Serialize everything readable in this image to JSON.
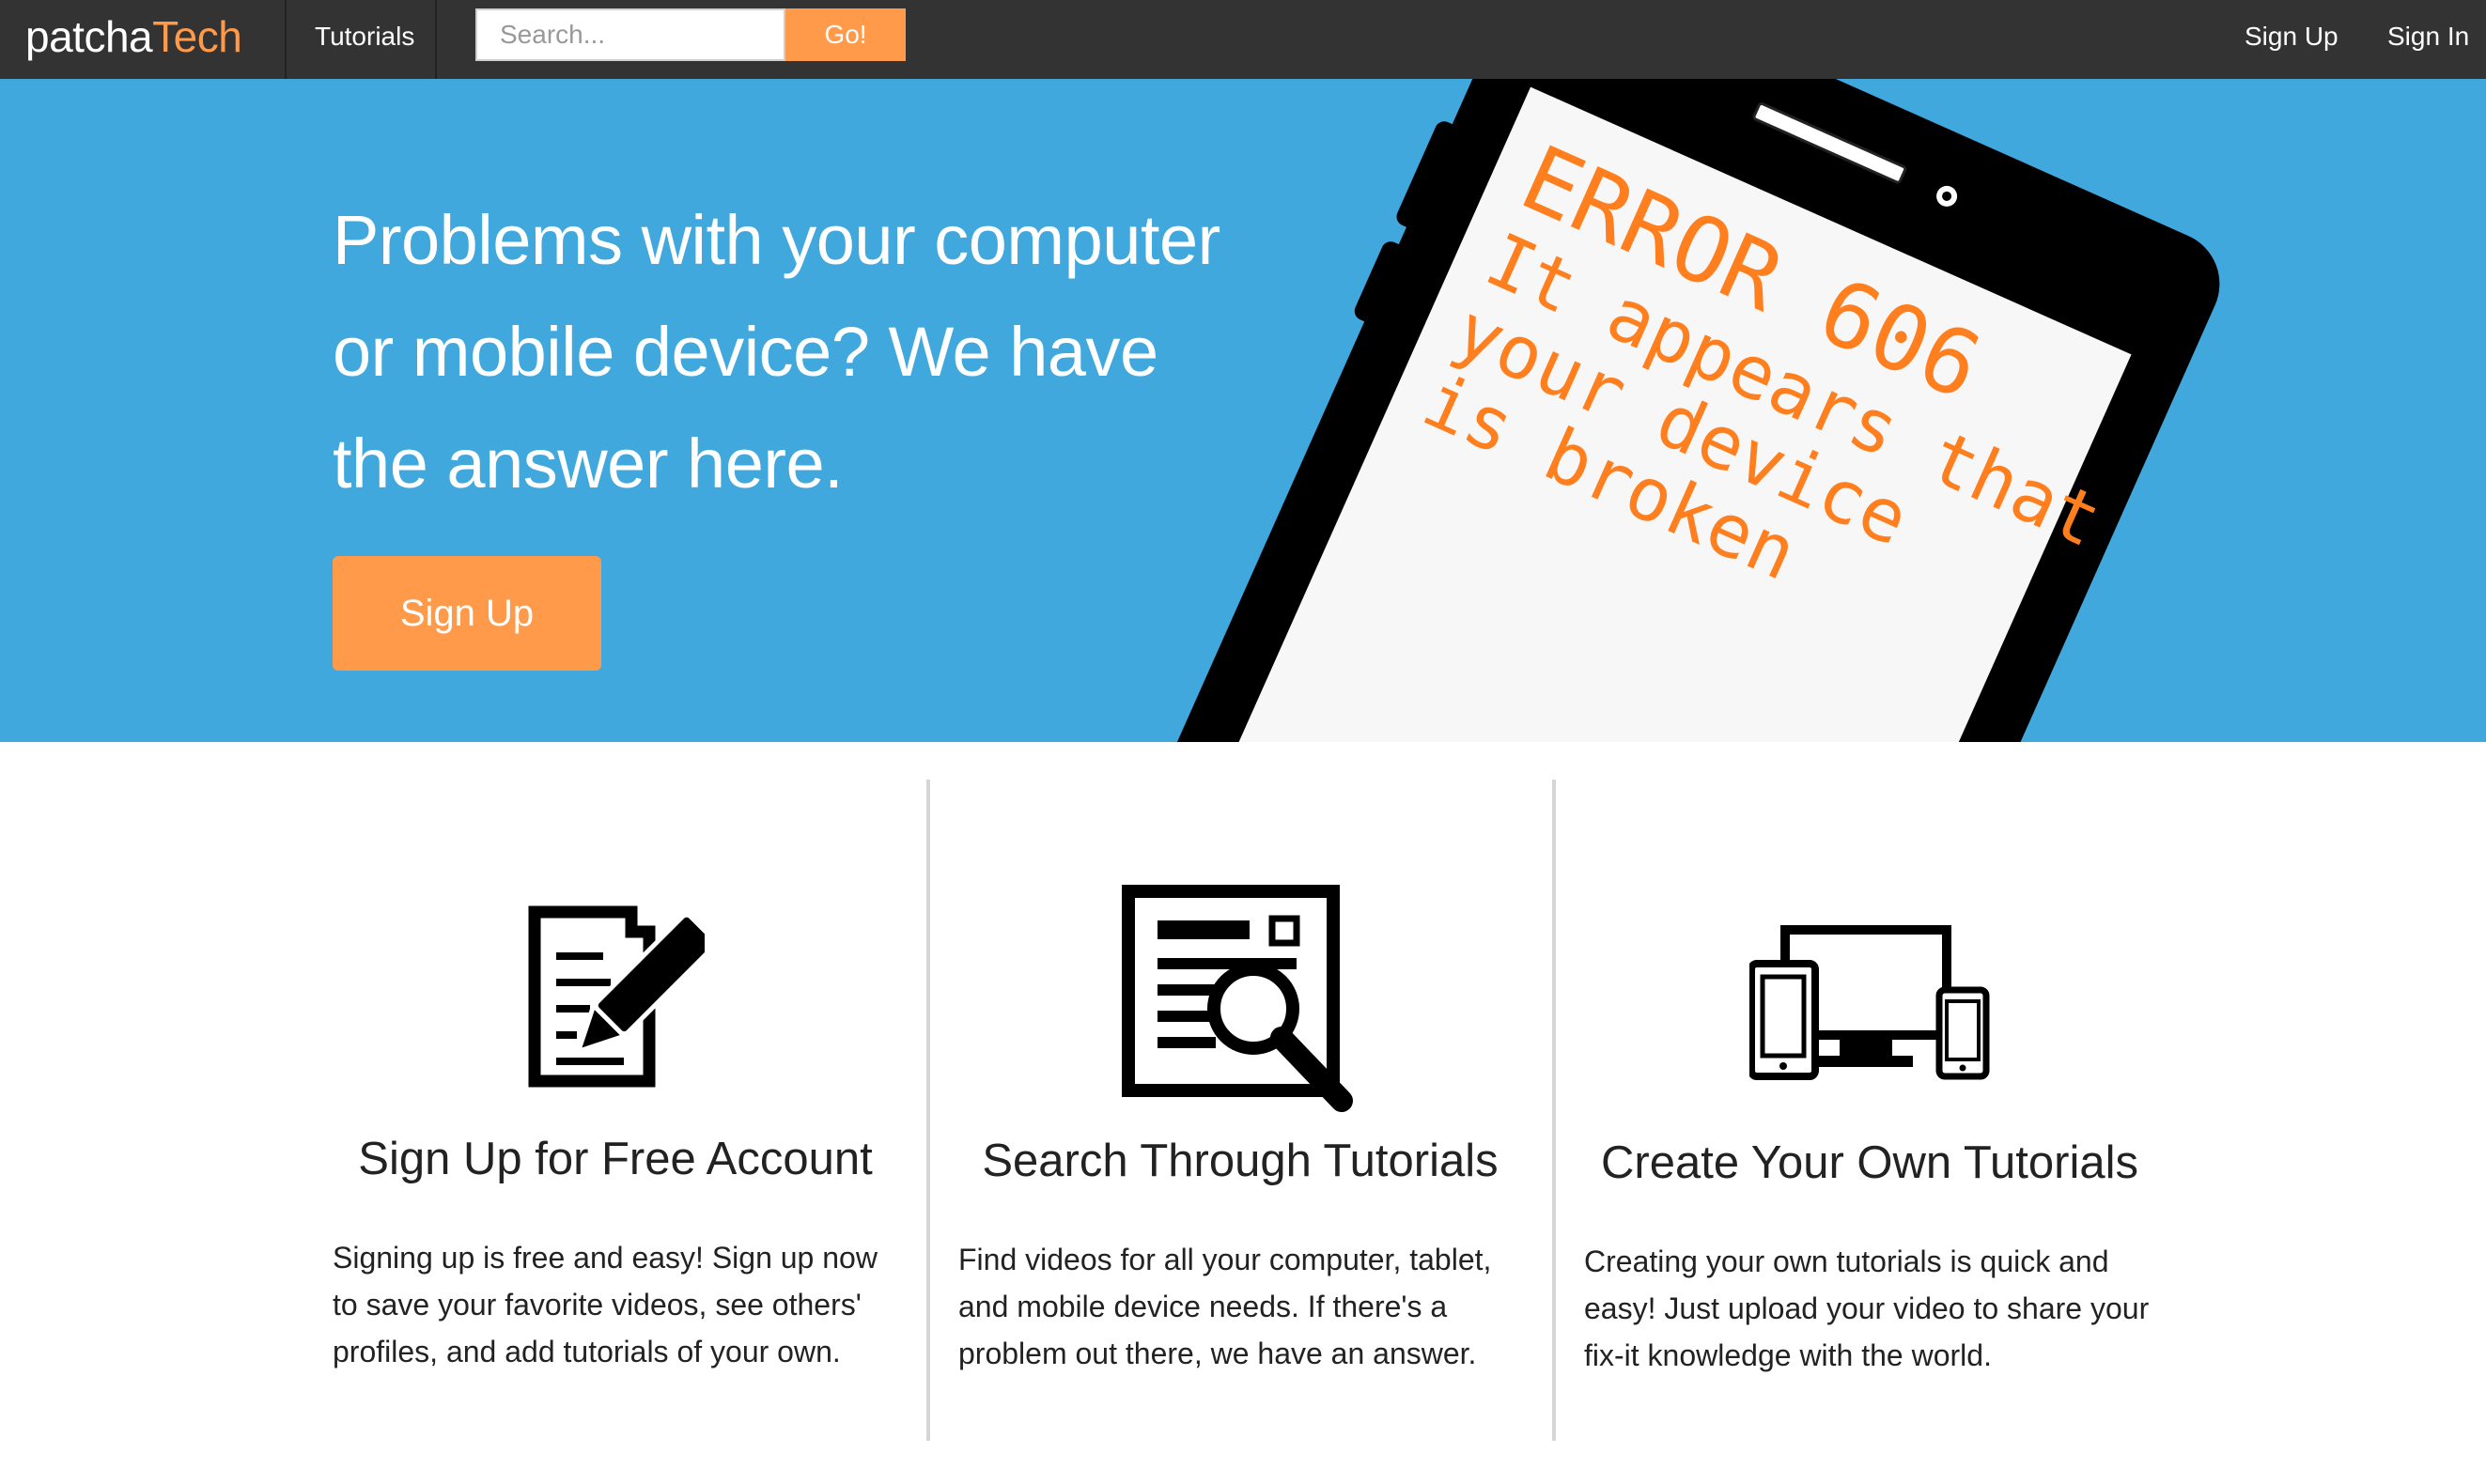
{
  "navbar": {
    "brand_part1": "patcha",
    "brand_part2": "Tech",
    "tutorials_label": "Tutorials",
    "search_placeholder": "Search...",
    "go_label": "Go!",
    "signup_label": "Sign Up",
    "signin_label": "Sign In"
  },
  "hero": {
    "title_lines": [
      "Problems with your computer",
      "or mobile device? We have",
      "the answer here."
    ],
    "signup_label": "Sign Up",
    "tablet_screen": {
      "error_line": "ERROR 606",
      "message_lines": [
        "It appears that",
        "your device",
        "is broken"
      ]
    }
  },
  "features": [
    {
      "icon": "document-pencil-icon",
      "title": "Sign Up for Free Account",
      "text_lines": [
        "Signing up is free and easy! Sign up now",
        "to save your favorite videos, see others'",
        "profiles, and add tutorials of your own."
      ]
    },
    {
      "icon": "browser-search-icon",
      "title": "Search Through Tutorials",
      "text_lines": [
        "Find videos for all your computer, tablet,",
        "and mobile device needs. If there's a",
        "problem out there, we have an answer."
      ]
    },
    {
      "icon": "devices-icon",
      "title": "Create Your Own Tutorials",
      "text_lines": [
        "Creating your own tutorials is quick and",
        "easy! Just upload your video to share your",
        "fix-it knowledge with the world."
      ]
    }
  ],
  "colors": {
    "navbar_bg": "#333333",
    "accent_orange": "#ff9a4a",
    "hero_blue": "#40a8dd",
    "error_text": "#ff7f1f"
  }
}
